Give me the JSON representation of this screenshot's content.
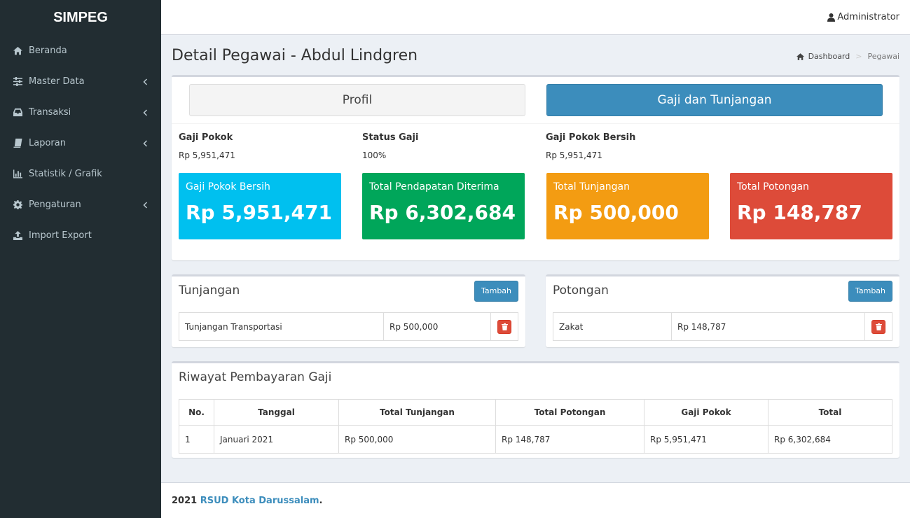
{
  "app": {
    "logo": "SIMPEG"
  },
  "sidebar": {
    "items": [
      {
        "label": "Beranda",
        "icon": "home-icon",
        "has_children": false
      },
      {
        "label": "Master Data",
        "icon": "sliders-icon",
        "has_children": true
      },
      {
        "label": "Transaksi",
        "icon": "inbox-icon",
        "has_children": true
      },
      {
        "label": "Laporan",
        "icon": "book-icon",
        "has_children": true
      },
      {
        "label": "Statistik / Grafik",
        "icon": "bar-chart-icon",
        "has_children": false
      },
      {
        "label": "Pengaturan",
        "icon": "gear-icon",
        "has_children": true
      },
      {
        "label": "Import Export",
        "icon": "upload-icon",
        "has_children": false
      }
    ]
  },
  "header": {
    "user": "Administrator"
  },
  "page": {
    "title": "Detail Pegawai - Abdul Lindgren",
    "breadcrumb": {
      "home": "Dashboard",
      "current": "Pegawai"
    }
  },
  "tabs": {
    "profile": "Profil",
    "salary": "Gaji dan Tunjangan"
  },
  "summary": {
    "gaji_pokok_label": "Gaji Pokok",
    "gaji_pokok_value": "Rp 5,951,471",
    "status_gaji_label": "Status Gaji",
    "status_gaji_value": "100%",
    "gaji_bersih_label": "Gaji Pokok Bersih",
    "gaji_bersih_value": "Rp 5,951,471"
  },
  "cards": [
    {
      "title": "Gaji Pokok Bersih",
      "value": "Rp 5,951,471",
      "color": "#00c0ef"
    },
    {
      "title": "Total Pendapatan Diterima",
      "value": "Rp 6,302,684",
      "color": "#00a65a"
    },
    {
      "title": "Total Tunjangan",
      "value": "Rp 500,000",
      "color": "#f39c12"
    },
    {
      "title": "Total Potongan",
      "value": "Rp 148,787",
      "color": "#dd4b39"
    }
  ],
  "tunjangan": {
    "title": "Tunjangan",
    "add_label": "Tambah",
    "rows": [
      {
        "name": "Tunjangan Transportasi",
        "amount": "Rp 500,000"
      }
    ]
  },
  "potongan": {
    "title": "Potongan",
    "add_label": "Tambah",
    "rows": [
      {
        "name": "Zakat",
        "amount": "Rp 148,787"
      }
    ]
  },
  "riwayat": {
    "title": "Riwayat Pembayaran Gaji",
    "headers": [
      "No.",
      "Tanggal",
      "Total Tunjangan",
      "Total Potongan",
      "Gaji Pokok",
      "Total"
    ],
    "rows": [
      [
        "1",
        "Januari 2021",
        "Rp 500,000",
        "Rp 148,787",
        "Rp 5,951,471",
        "Rp 6,302,684"
      ]
    ]
  },
  "footer": {
    "year": "2021",
    "org": "RSUD Kota Darussalam",
    "suffix": "."
  }
}
